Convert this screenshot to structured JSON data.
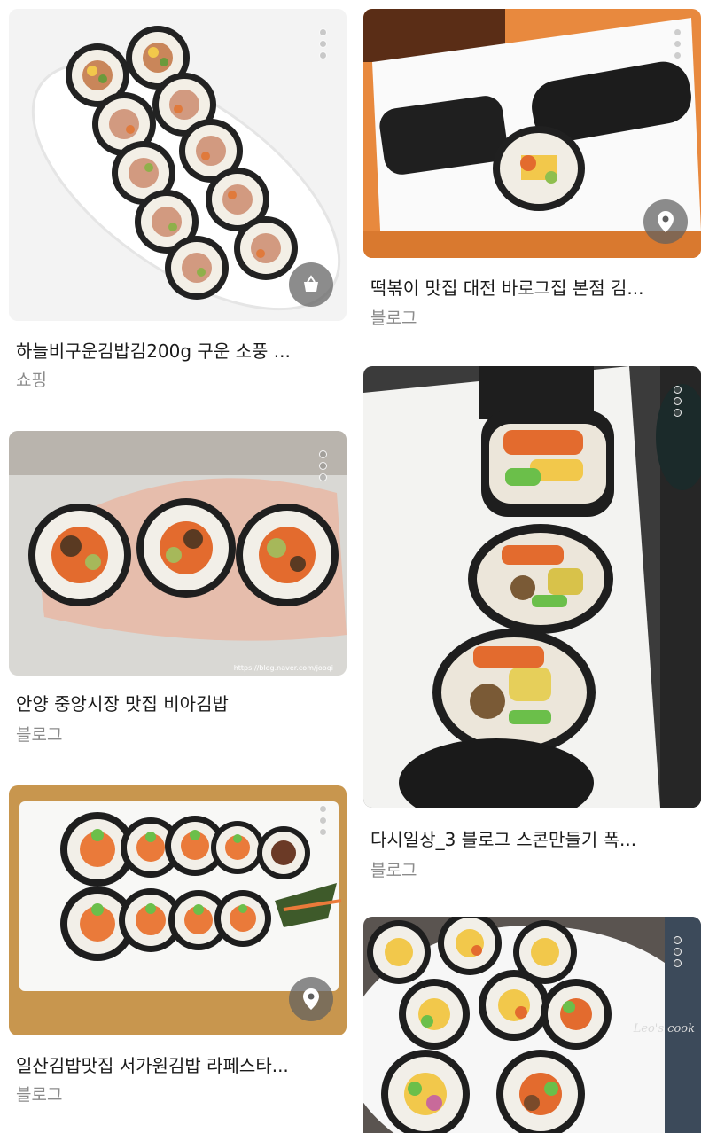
{
  "results": [
    {
      "title": "하늘비구운김밥김200g 구운 소풍 ...",
      "source": "쇼핑",
      "badge": "shopping-bag-icon"
    },
    {
      "title": "떡볶이 맛집 대전 바로그집 본점 김...",
      "source": "블로그",
      "badge": "location-pin-icon"
    },
    {
      "title": "안양 중앙시장 맛집 비아김밥",
      "source": "블로그",
      "watermark": "https://blog.naver.com/jooqi"
    },
    {
      "title": "다시일상_3 블로그 스콘만들기 폭...",
      "source": "블로그"
    },
    {
      "title": "일산김밥맛집 서가원김밥 라페스타...",
      "source": "블로그",
      "badge": "location-pin-icon"
    },
    {
      "title": "",
      "source": "",
      "watermark": "Leo's cook"
    }
  ],
  "colors": {
    "title_text": "#1a1a1a",
    "source_text": "#8b8b8b",
    "badge_bg": "#5f5f5f"
  }
}
